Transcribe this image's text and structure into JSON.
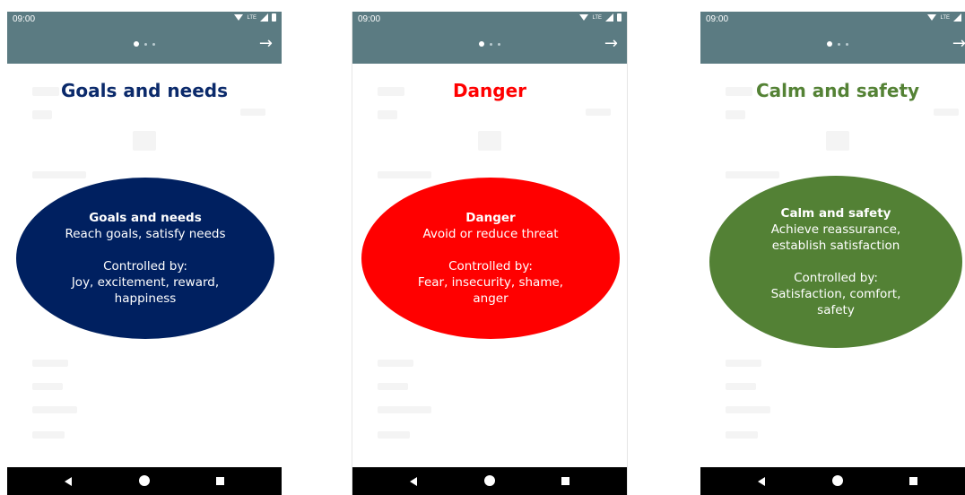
{
  "status_bar": {
    "time": "09:00",
    "network_label": "LTE"
  },
  "nav": {
    "next_symbol": "→"
  },
  "screens": [
    {
      "heading": "Goals and needs",
      "heading_color": "#0b2a6b",
      "ellipse_color": "#002060",
      "ellipse_title": "Goals and needs",
      "ellipse_line1": "Reach goals, satisfy needs",
      "ellipse_line2": "",
      "controlled_label": "Controlled by:",
      "controlled_line1": "Joy, excitement, reward,",
      "controlled_line2": "happiness"
    },
    {
      "heading": "Danger",
      "heading_color": "#ff0000",
      "ellipse_color": "#ff0000",
      "ellipse_title": "Danger",
      "ellipse_line1": "Avoid or reduce threat",
      "ellipse_line2": "",
      "controlled_label": "Controlled by:",
      "controlled_line1": "Fear, insecurity, shame,",
      "controlled_line2": "anger"
    },
    {
      "heading": "Calm and safety",
      "heading_color": "#548235",
      "ellipse_color": "#538135",
      "ellipse_title": "Calm and safety",
      "ellipse_line1": "Achieve reassurance,",
      "ellipse_line2": "establish satisfaction",
      "controlled_label": "Controlled by:",
      "controlled_line1": "Satisfaction, comfort,",
      "controlled_line2": "safety"
    }
  ]
}
